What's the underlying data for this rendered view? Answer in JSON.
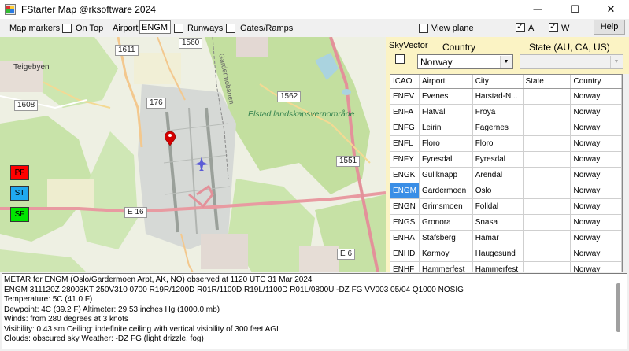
{
  "window": {
    "title": "FStarter Map @rksoftware 2024",
    "minimize_glyph": "—",
    "maximize_glyph": "☐",
    "close_glyph": "✕"
  },
  "toolbar": {
    "map_markers_label": "Map markers",
    "on_top_label": "On Top",
    "on_top_checked": false,
    "airport_label": "Airport",
    "airport_value": "ENGM",
    "runways_label": "Runways",
    "runways_checked": false,
    "gates_label": "Gates/Ramps",
    "gates_checked": false,
    "view_plane_label": "View plane",
    "view_plane_checked": false,
    "a_label": "A",
    "a_checked": true,
    "w_label": "W",
    "w_checked": true,
    "help_label": "Help"
  },
  "map": {
    "road_labels": [
      "1611",
      "1560",
      "1608",
      "176",
      "1562",
      "1551",
      "E 16",
      "E 6"
    ],
    "place_label": "Teigebyen",
    "park_label": "Elstad landskapsvernområde",
    "road_name": "Gardermobanen",
    "buttons": [
      {
        "label": "PF",
        "color": "#ff0000"
      },
      {
        "label": "ST",
        "color": "#1fa9f0"
      },
      {
        "label": "SF",
        "color": "#00e600"
      }
    ]
  },
  "panel": {
    "skyvector_label": "SkyVector",
    "skyvector_checked": false,
    "country_label": "Country",
    "state_label": "State (AU, CA, US)",
    "country_value": "Norway",
    "state_value": ""
  },
  "grid": {
    "columns": [
      "ICAO",
      "Airport",
      "City",
      "State",
      "Country"
    ],
    "rows": [
      [
        "ENEV",
        "Evenes",
        "Harstad-N...",
        "",
        "Norway"
      ],
      [
        "ENFA",
        "Flatval",
        "Froya",
        "",
        "Norway"
      ],
      [
        "ENFG",
        "Leirin",
        "Fagernes",
        "",
        "Norway"
      ],
      [
        "ENFL",
        "Floro",
        "Floro",
        "",
        "Norway"
      ],
      [
        "ENFY",
        "Fyresdal",
        "Fyresdal",
        "",
        "Norway"
      ],
      [
        "ENGK",
        "Gullknapp",
        "Arendal",
        "",
        "Norway"
      ],
      [
        "ENGM",
        "Gardermoen",
        "Oslo",
        "",
        "Norway"
      ],
      [
        "ENGN",
        "Grimsmoen",
        "Folldal",
        "",
        "Norway"
      ],
      [
        "ENGS",
        "Gronora",
        "Snasa",
        "",
        "Norway"
      ],
      [
        "ENHA",
        "Stafsberg",
        "Hamar",
        "",
        "Norway"
      ],
      [
        "ENHD",
        "Karmoy",
        "Haugesund",
        "",
        "Norway"
      ],
      [
        "ENHF",
        "Hammerfest",
        "Hammerfest",
        "",
        "Norway"
      ]
    ],
    "selected_index": 6
  },
  "metar": {
    "lines": [
      "METAR for ENGM (Oslo/Gardermoen Arpt, AK, NO) observed at 1120 UTC 31 Mar 2024",
      "ENGM 311120Z 28003KT 250V310 0700 R19R/1200D R01R/1100D R19L/1100D R01L/0800U -DZ FG VV003 05/04 Q1000 NOSIG",
      "Temperature: 5C (41.0 F)",
      "Dewpoint: 4C (39.2 F)  Altimeter: 29.53 inches Hg (1000.0 mb)",
      "Winds: from 280 degrees at 3 knots",
      "Visibility: 0.43 sm  Ceiling: indefinite ceiling with vertical visibility of 300 feet AGL",
      "Clouds: obscured sky  Weather: -DZ FG (light drizzle, fog)"
    ]
  }
}
